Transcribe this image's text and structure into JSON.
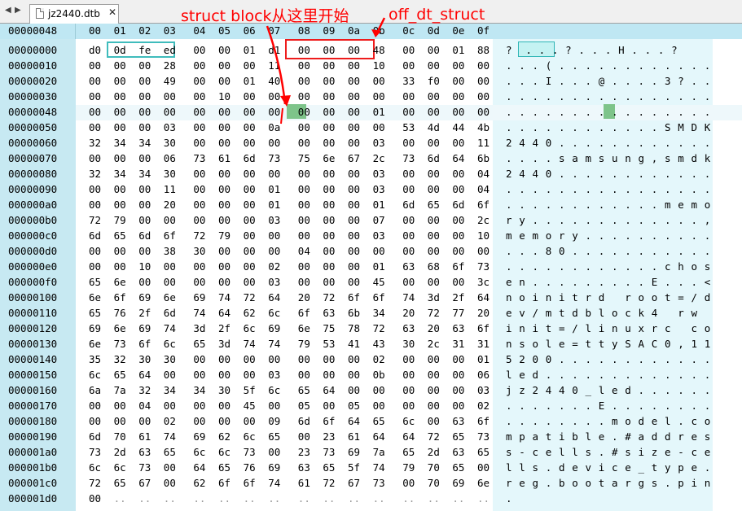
{
  "tab": {
    "filename": "jz2440.dtb",
    "close": "✕",
    "back": "◀",
    "forward": "▶"
  },
  "header": {
    "offset": "00000048",
    "columns": [
      "00",
      "01",
      "02",
      "03",
      "04",
      "05",
      "06",
      "07",
      "08",
      "09",
      "0a",
      "0b",
      "0c",
      "0d",
      "0e",
      "0f"
    ]
  },
  "rows": [
    {
      "offset": "00000000",
      "bytes": [
        "d0",
        "0d",
        "fe",
        "ed",
        "00",
        "00",
        "01",
        "d1",
        "00",
        "00",
        "00",
        "48",
        "00",
        "00",
        "01",
        "88"
      ],
      "ascii": "?  . . . ? . . . H . . . ?"
    },
    {
      "offset": "00000010",
      "bytes": [
        "00",
        "00",
        "00",
        "28",
        "00",
        "00",
        "00",
        "11",
        "00",
        "00",
        "00",
        "10",
        "00",
        "00",
        "00",
        "00"
      ],
      "ascii": ". . . ( . . . . . . . . . . . ."
    },
    {
      "offset": "00000020",
      "bytes": [
        "00",
        "00",
        "00",
        "49",
        "00",
        "00",
        "01",
        "40",
        "00",
        "00",
        "00",
        "00",
        "33",
        "f0",
        "00",
        "00"
      ],
      "ascii": ". . . I . . . @ . . . . 3 ? . ."
    },
    {
      "offset": "00000030",
      "bytes": [
        "00",
        "00",
        "00",
        "00",
        "00",
        "10",
        "00",
        "00",
        "00",
        "00",
        "00",
        "00",
        "00",
        "00",
        "00",
        "00"
      ],
      "ascii": ". . . . . . . . . . . . . . . ."
    },
    {
      "offset": "00000048",
      "bytes": [
        "00",
        "00",
        "00",
        "00",
        "00",
        "00",
        "00",
        "00",
        "00",
        "00",
        "00",
        "01",
        "00",
        "00",
        "00",
        "00"
      ],
      "ascii": ". . . . . . . . . . . . . . . ."
    },
    {
      "offset": "00000050",
      "bytes": [
        "00",
        "00",
        "00",
        "03",
        "00",
        "00",
        "00",
        "0a",
        "00",
        "00",
        "00",
        "00",
        "53",
        "4d",
        "44",
        "4b"
      ],
      "ascii": ". . . . . . . . . . . . S M D K"
    },
    {
      "offset": "00000060",
      "bytes": [
        "32",
        "34",
        "34",
        "30",
        "00",
        "00",
        "00",
        "00",
        "00",
        "00",
        "00",
        "03",
        "00",
        "00",
        "00",
        "11"
      ],
      "ascii": "2 4 4 0 . . . . . . . . . . . ."
    },
    {
      "offset": "00000070",
      "bytes": [
        "00",
        "00",
        "00",
        "06",
        "73",
        "61",
        "6d",
        "73",
        "75",
        "6e",
        "67",
        "2c",
        "73",
        "6d",
        "64",
        "6b"
      ],
      "ascii": ". . . . s a m s u n g , s m d k"
    },
    {
      "offset": "00000080",
      "bytes": [
        "32",
        "34",
        "34",
        "30",
        "00",
        "00",
        "00",
        "00",
        "00",
        "00",
        "00",
        "03",
        "00",
        "00",
        "00",
        "04"
      ],
      "ascii": "2 4 4 0 . . . . . . . . . . . ."
    },
    {
      "offset": "00000090",
      "bytes": [
        "00",
        "00",
        "00",
        "11",
        "00",
        "00",
        "00",
        "01",
        "00",
        "00",
        "00",
        "03",
        "00",
        "00",
        "00",
        "04"
      ],
      "ascii": ". . . . . . . . . . . . . . . ."
    },
    {
      "offset": "000000a0",
      "bytes": [
        "00",
        "00",
        "00",
        "20",
        "00",
        "00",
        "00",
        "01",
        "00",
        "00",
        "00",
        "01",
        "6d",
        "65",
        "6d",
        "6f"
      ],
      "ascii": ". . . . . . . . . . . . m e m o"
    },
    {
      "offset": "000000b0",
      "bytes": [
        "72",
        "79",
        "00",
        "00",
        "00",
        "00",
        "00",
        "03",
        "00",
        "00",
        "00",
        "07",
        "00",
        "00",
        "00",
        "2c"
      ],
      "ascii": "r y . . . . . . . . . . . . . ,"
    },
    {
      "offset": "000000c0",
      "bytes": [
        "6d",
        "65",
        "6d",
        "6f",
        "72",
        "79",
        "00",
        "00",
        "00",
        "00",
        "00",
        "03",
        "00",
        "00",
        "00",
        "10"
      ],
      "ascii": "m e m o r y . . . . . . . . . ."
    },
    {
      "offset": "000000d0",
      "bytes": [
        "00",
        "00",
        "00",
        "38",
        "30",
        "00",
        "00",
        "00",
        "04",
        "00",
        "00",
        "00",
        "00",
        "00",
        "00",
        "00"
      ],
      "ascii": ". . . 8 0 . . . . . . . . . . ."
    },
    {
      "offset": "000000e0",
      "bytes": [
        "00",
        "00",
        "10",
        "00",
        "00",
        "00",
        "00",
        "02",
        "00",
        "00",
        "00",
        "01",
        "63",
        "68",
        "6f",
        "73"
      ],
      "ascii": ". . . . . . . . . . . . c h o s"
    },
    {
      "offset": "000000f0",
      "bytes": [
        "65",
        "6e",
        "00",
        "00",
        "00",
        "00",
        "00",
        "03",
        "00",
        "00",
        "00",
        "45",
        "00",
        "00",
        "00",
        "3c"
      ],
      "ascii": "e n . . . . . . . . . E . . . <"
    },
    {
      "offset": "00000100",
      "bytes": [
        "6e",
        "6f",
        "69",
        "6e",
        "69",
        "74",
        "72",
        "64",
        "20",
        "72",
        "6f",
        "6f",
        "74",
        "3d",
        "2f",
        "64"
      ],
      "ascii": "n o i n i t r d   r o o t = / d"
    },
    {
      "offset": "00000110",
      "bytes": [
        "65",
        "76",
        "2f",
        "6d",
        "74",
        "64",
        "62",
        "6c",
        "6f",
        "63",
        "6b",
        "34",
        "20",
        "72",
        "77",
        "20"
      ],
      "ascii": "e v / m t d b l o c k 4   r w"
    },
    {
      "offset": "00000120",
      "bytes": [
        "69",
        "6e",
        "69",
        "74",
        "3d",
        "2f",
        "6c",
        "69",
        "6e",
        "75",
        "78",
        "72",
        "63",
        "20",
        "63",
        "6f"
      ],
      "ascii": "i n i t = / l i n u x r c   c o"
    },
    {
      "offset": "00000130",
      "bytes": [
        "6e",
        "73",
        "6f",
        "6c",
        "65",
        "3d",
        "74",
        "74",
        "79",
        "53",
        "41",
        "43",
        "30",
        "2c",
        "31",
        "31"
      ],
      "ascii": "n s o l e = t t y S A C 0 , 1 1"
    },
    {
      "offset": "00000140",
      "bytes": [
        "35",
        "32",
        "30",
        "30",
        "00",
        "00",
        "00",
        "00",
        "00",
        "00",
        "00",
        "02",
        "00",
        "00",
        "00",
        "01"
      ],
      "ascii": "5 2 0 0 . . . . . . . . . . . ."
    },
    {
      "offset": "00000150",
      "bytes": [
        "6c",
        "65",
        "64",
        "00",
        "00",
        "00",
        "00",
        "03",
        "00",
        "00",
        "00",
        "0b",
        "00",
        "00",
        "00",
        "06"
      ],
      "ascii": "l e d . . . . . . . . . . . . ."
    },
    {
      "offset": "00000160",
      "bytes": [
        "6a",
        "7a",
        "32",
        "34",
        "34",
        "30",
        "5f",
        "6c",
        "65",
        "64",
        "00",
        "00",
        "00",
        "00",
        "00",
        "03"
      ],
      "ascii": "j z 2 4 4 0 _ l e d . . . . . ."
    },
    {
      "offset": "00000170",
      "bytes": [
        "00",
        "00",
        "04",
        "00",
        "00",
        "00",
        "45",
        "00",
        "05",
        "00",
        "05",
        "00",
        "00",
        "00",
        "00",
        "02"
      ],
      "ascii": ". . . . . . . E . . . . . . . ."
    },
    {
      "offset": "00000180",
      "bytes": [
        "00",
        "00",
        "00",
        "02",
        "00",
        "00",
        "00",
        "09",
        "6d",
        "6f",
        "64",
        "65",
        "6c",
        "00",
        "63",
        "6f"
      ],
      "ascii": ". . . . . . . . m o d e l . c o"
    },
    {
      "offset": "00000190",
      "bytes": [
        "6d",
        "70",
        "61",
        "74",
        "69",
        "62",
        "6c",
        "65",
        "00",
        "23",
        "61",
        "64",
        "64",
        "72",
        "65",
        "73"
      ],
      "ascii": "m p a t i b l e . # a d d r e s"
    },
    {
      "offset": "000001a0",
      "bytes": [
        "73",
        "2d",
        "63",
        "65",
        "6c",
        "6c",
        "73",
        "00",
        "23",
        "73",
        "69",
        "7a",
        "65",
        "2d",
        "63",
        "65"
      ],
      "ascii": "s - c e l l s . # s i z e - c e"
    },
    {
      "offset": "000001b0",
      "bytes": [
        "6c",
        "6c",
        "73",
        "00",
        "64",
        "65",
        "76",
        "69",
        "63",
        "65",
        "5f",
        "74",
        "79",
        "70",
        "65",
        "00"
      ],
      "ascii": "l l s . d e v i c e _ t y p e ."
    },
    {
      "offset": "000001c0",
      "bytes": [
        "72",
        "65",
        "67",
        "00",
        "62",
        "6f",
        "6f",
        "74",
        "61",
        "72",
        "67",
        "73",
        "00",
        "70",
        "69",
        "6e"
      ],
      "ascii": "r e g . b o o t a r g s . p i n"
    },
    {
      "offset": "000001d0",
      "bytes": [
        "00",
        "..",
        "..",
        "..",
        "..",
        "..",
        "..",
        "..",
        "..",
        "..",
        "..",
        "..",
        "..",
        "..",
        "..",
        ".."
      ],
      "ascii": "."
    }
  ],
  "annotations": {
    "struct_block": "struct block从这里开始",
    "off_dt_struct": "off_dt_struct"
  },
  "colors": {
    "accent_teal": "#3fbcbc",
    "highlight_green": "#7ec48a",
    "annotation_red": "#ff0000",
    "offset_col_bg": "#c7e9f2"
  }
}
